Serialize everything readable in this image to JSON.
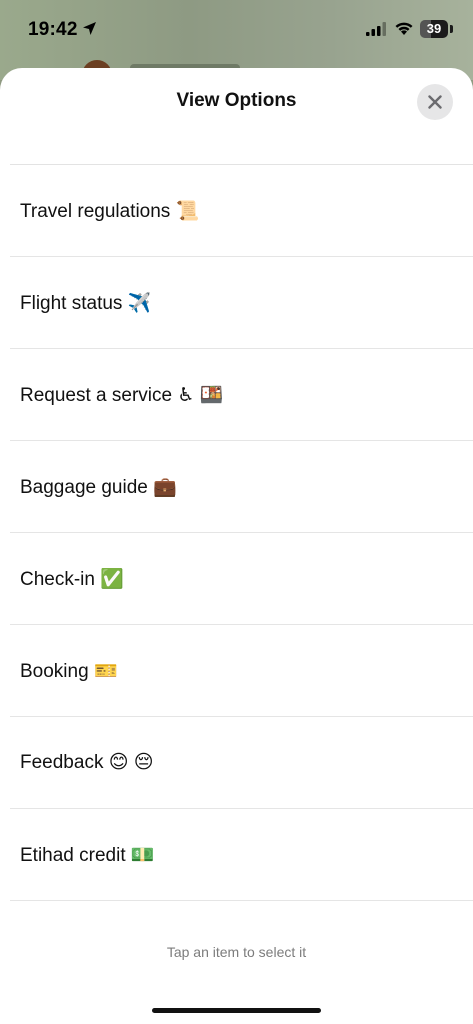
{
  "status_bar": {
    "time": "19:42",
    "battery": "39",
    "battery_level": 0.39
  },
  "sheet": {
    "title": "View Options",
    "close_icon": "close-icon",
    "items": [
      {
        "label": "Travel regulations 📜"
      },
      {
        "label": "Flight status ✈️"
      },
      {
        "label": "Request a service ♿ 🍱"
      },
      {
        "label": "Baggage guide 💼"
      },
      {
        "label": "Check-in ✅"
      },
      {
        "label": "Booking 🎫"
      },
      {
        "label": "Feedback 😊 😔"
      },
      {
        "label": "Etihad credit 💵"
      }
    ],
    "footer_hint": "Tap an item to select it"
  }
}
